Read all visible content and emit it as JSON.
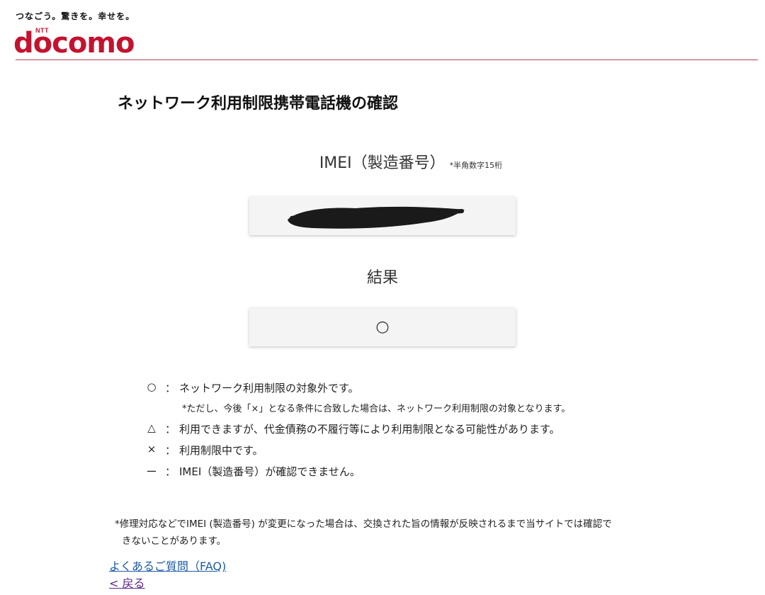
{
  "header": {
    "tagline": "つなごう。驚きを。幸せを。",
    "logo_ntt": "NTT",
    "logo": "docomo",
    "brand_color": "#c4122f"
  },
  "page": {
    "title": "ネットワーク利用制限携帯電話機の確認"
  },
  "imei": {
    "label": "IMEI（製造番号）",
    "note": "*半角数字15桁",
    "value_redacted": true
  },
  "result": {
    "label": "結果",
    "value": "○"
  },
  "legend": [
    {
      "symbol": "○",
      "colon": "：",
      "text": "ネットワーク利用制限の対象外です。",
      "subnote": "*ただし、今後「×」となる条件に合致した場合は、ネットワーク利用制限の対象となります。"
    },
    {
      "symbol": "△",
      "colon": "：",
      "text": "利用できますが、代金債務の不履行等により利用制限となる可能性があります。"
    },
    {
      "symbol": "×",
      "colon": "：",
      "text": "利用制限中です。"
    },
    {
      "symbol": "ー",
      "colon": "：",
      "text": "IMEI（製造番号）が確認できません。"
    }
  ],
  "footnote": {
    "line1": "*修理対応などでIMEI (製造番号) が変更になった場合は、交換された旨の情報が反映されるまで当サイトでは確認で",
    "line2": "きないことがあります。"
  },
  "links": {
    "faq": "よくあるご質問（FAQ)",
    "back": "< 戻る"
  }
}
